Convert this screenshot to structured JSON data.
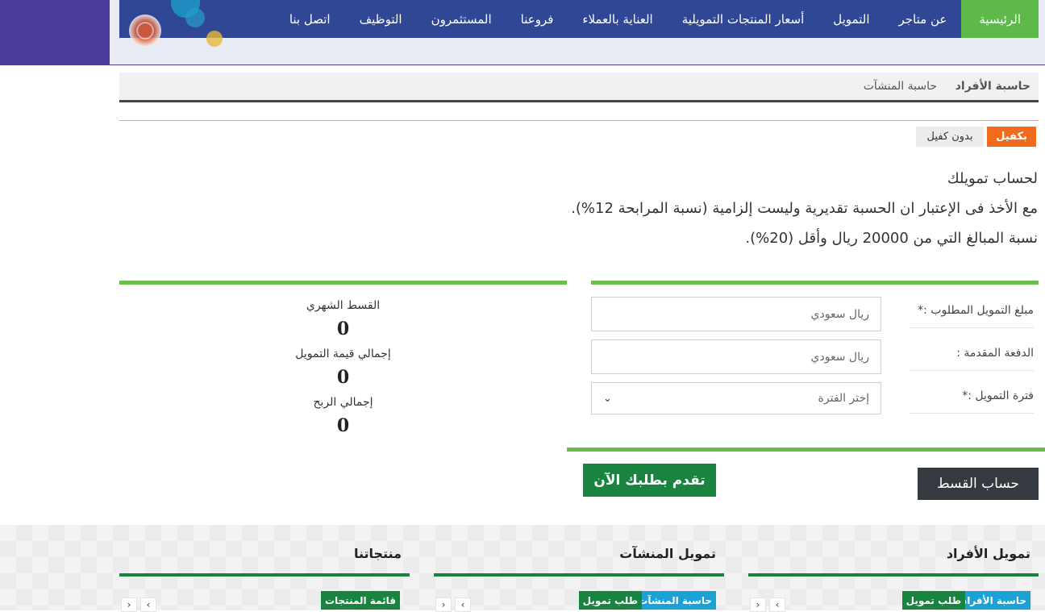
{
  "nav": {
    "items": [
      {
        "label": "الرئيسية",
        "active": true
      },
      {
        "label": "عن متاجر"
      },
      {
        "label": "التمويل"
      },
      {
        "label": "أسعار المنتجات التمويلية"
      },
      {
        "label": "العناية بالعملاء"
      },
      {
        "label": "فروعنا"
      },
      {
        "label": "المستثمرون"
      },
      {
        "label": "التوظيف"
      },
      {
        "label": "اتصل بنا"
      }
    ]
  },
  "calc_tabs": {
    "individuals": "حاسبة الأفراد",
    "facilities": "حاسبة المنشآت"
  },
  "guarantee": {
    "with": "بكفيل",
    "without": "بدون كفيل"
  },
  "intro": {
    "line1": "لحساب تمويلك",
    "line2": "مع الأخذ فى الإعتبار ان الحسبة تقديرية وليست إلزامية (نسبة المرابحة 12%).",
    "line3": "نسبة المبالغ التي من 20000 ريال وأقل (20%)."
  },
  "form": {
    "amount_label": "مبلغ التمويل المطلوب :*",
    "amount_placeholder": "ريال سعودي",
    "down_label": "الدفعة المقدمة :",
    "down_placeholder": "ريال سعودي",
    "period_label": "فترة التمويل :*",
    "period_selected": "إختر الفترة"
  },
  "results": {
    "monthly_label": "القسط الشهري",
    "monthly_value": "0",
    "total_label": "إجمالي قيمة التمويل",
    "total_value": "0",
    "profit_label": "إجمالي الربح",
    "profit_value": "0"
  },
  "buttons": {
    "calculate": "حساب القسط",
    "apply": "تقدم بطلبك الآن"
  },
  "footer": {
    "individuals": {
      "title": "تمويل الأفراد",
      "btn_calc": "حاسبة الأفراد",
      "btn_request": "طلب تمويل"
    },
    "facilities": {
      "title": "تمويل المنشآت",
      "btn_calc": "حاسبة المنشآت",
      "btn_request": "طلب تمويل"
    },
    "products": {
      "title": "منتجاتنا",
      "btn_list": "قائمة المنتجات"
    }
  },
  "colors": {
    "nav_bg": "#2f4795",
    "nav_active": "#5cb94a",
    "header_band": "#4b3b9a",
    "accent_green": "#6abf4b",
    "dark_green": "#19843f",
    "orange": "#f26a1b",
    "blue": "#1ba1d6"
  }
}
